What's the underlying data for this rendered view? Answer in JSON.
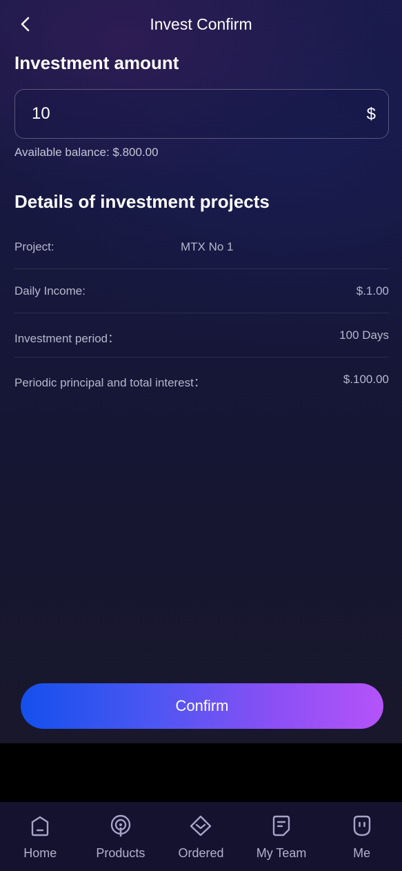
{
  "header": {
    "title": "Invest Confirm"
  },
  "amount": {
    "section_title": "Investment amount",
    "value": "10",
    "currency_symbol": "$",
    "balance_text": "Available balance: $.800.00"
  },
  "details": {
    "section_title": "Details of investment projects",
    "rows": [
      {
        "label": "Project:",
        "value": "MTX No 1"
      },
      {
        "label": "Daily Income:",
        "value": "$.1.00"
      },
      {
        "label": "Investment period：",
        "value": "100 Days"
      },
      {
        "label": "Periodic principal and total interest：",
        "value": "$.100.00"
      }
    ]
  },
  "confirm_label": "Confirm",
  "tabbar": {
    "items": [
      {
        "label": "Home",
        "icon": "home-icon"
      },
      {
        "label": "Products",
        "icon": "podcast-icon"
      },
      {
        "label": "Ordered",
        "icon": "diamond-check-icon"
      },
      {
        "label": "My Team",
        "icon": "note-icon"
      },
      {
        "label": "Me",
        "icon": "face-icon"
      }
    ]
  },
  "colors": {
    "button_gradient_start": "#1450ec",
    "button_gradient_end": "#b553fa",
    "tabbar_bg": "#151230",
    "tab_icon": "#a8a4c8"
  }
}
